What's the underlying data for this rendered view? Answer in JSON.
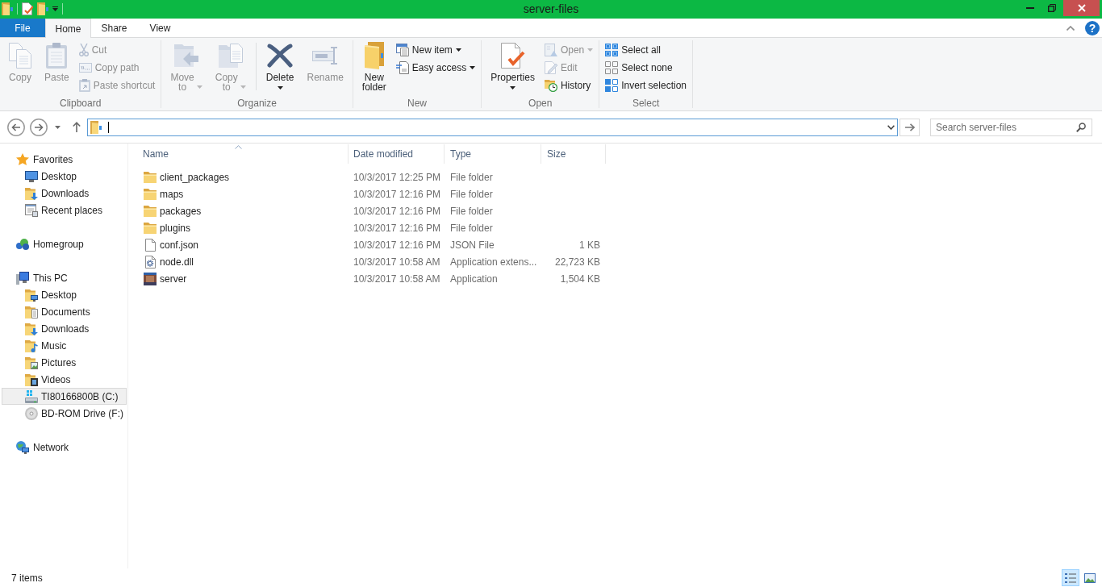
{
  "window": {
    "title": "server-files"
  },
  "ribbon": {
    "tabs": [
      {
        "label": "File",
        "kind": "menu",
        "selected": false
      },
      {
        "label": "Home",
        "kind": "tab",
        "selected": true
      },
      {
        "label": "Share",
        "kind": "tab",
        "selected": false
      },
      {
        "label": "View",
        "kind": "tab",
        "selected": false
      }
    ],
    "help_button": {
      "label": "?"
    },
    "groups": [
      {
        "label": "Clipboard",
        "commands": [
          {
            "label": "Copy",
            "kind": "large",
            "dropdown": false,
            "disabled": true
          },
          {
            "label": "Paste",
            "kind": "large",
            "dropdown": false,
            "disabled": true
          },
          {
            "label": "Cut",
            "kind": "small",
            "dropdown": false,
            "disabled": true
          },
          {
            "label": "Copy path",
            "kind": "small",
            "dropdown": false,
            "disabled": true
          },
          {
            "label": "Paste shortcut",
            "kind": "small",
            "dropdown": false,
            "disabled": true
          }
        ]
      },
      {
        "label": "Organize",
        "commands": [
          {
            "label": "Move to",
            "kind": "large",
            "dropdown": true,
            "disabled": true
          },
          {
            "label": "Copy to",
            "kind": "large",
            "dropdown": true,
            "disabled": true
          },
          {
            "label": "Delete",
            "kind": "split",
            "dropdown": true,
            "disabled": false,
            "divider_before": true
          },
          {
            "label": "Rename",
            "kind": "large",
            "dropdown": false,
            "disabled": true
          }
        ]
      },
      {
        "label": "New",
        "commands": [
          {
            "label": "New folder",
            "kind": "large",
            "dropdown": false,
            "disabled": false
          },
          {
            "label": "New item",
            "kind": "small",
            "dropdown": true,
            "disabled": false
          },
          {
            "label": "Easy access",
            "kind": "small",
            "dropdown": true,
            "disabled": false
          }
        ]
      },
      {
        "label": "Open",
        "commands": [
          {
            "label": "Properties",
            "kind": "split",
            "dropdown": true,
            "disabled": false
          },
          {
            "label": "Open",
            "kind": "small",
            "dropdown": true,
            "disabled": true
          },
          {
            "label": "Edit",
            "kind": "small",
            "dropdown": false,
            "disabled": true
          },
          {
            "label": "History",
            "kind": "small",
            "dropdown": false,
            "disabled": false
          }
        ]
      },
      {
        "label": "Select",
        "commands": [
          {
            "label": "Select all",
            "kind": "small",
            "dropdown": false,
            "disabled": false
          },
          {
            "label": "Select none",
            "kind": "small",
            "dropdown": false,
            "disabled": false
          },
          {
            "label": "Invert selection",
            "kind": "small",
            "dropdown": false,
            "disabled": false
          }
        ]
      }
    ]
  },
  "search": {
    "placeholder": "Search server-files"
  },
  "nav": {
    "sections": [
      {
        "label": "Favorites",
        "selected": false,
        "children": [
          {
            "label": "Desktop",
            "selected": false
          },
          {
            "label": "Downloads",
            "selected": false
          },
          {
            "label": "Recent places",
            "selected": false
          }
        ]
      },
      {
        "label": "Homegroup",
        "selected": false
      },
      {
        "label": "This PC",
        "selected": false,
        "children": [
          {
            "label": "Desktop",
            "selected": false
          },
          {
            "label": "Documents",
            "selected": false
          },
          {
            "label": "Downloads",
            "selected": false
          },
          {
            "label": "Music",
            "selected": false
          },
          {
            "label": "Pictures",
            "selected": false
          },
          {
            "label": "Videos",
            "selected": false
          },
          {
            "label": "TI80166800B (C:)",
            "selected": true
          },
          {
            "label": "BD-ROM Drive (F:)",
            "selected": false
          }
        ]
      },
      {
        "label": "Network",
        "selected": false
      }
    ]
  },
  "file_list": {
    "columns": [
      {
        "label": "Name",
        "sorted": true
      },
      {
        "label": "Date modified",
        "sorted": false
      },
      {
        "label": "Type",
        "sorted": false
      },
      {
        "label": "Size",
        "sorted": false
      }
    ],
    "rows": [
      {
        "kind": "folder",
        "name": "client_packages",
        "date_modified": "10/3/2017 12:25 PM",
        "type": "File folder"
      },
      {
        "kind": "folder",
        "name": "maps",
        "date_modified": "10/3/2017 12:16 PM",
        "type": "File folder"
      },
      {
        "kind": "folder",
        "name": "packages",
        "date_modified": "10/3/2017 12:16 PM",
        "type": "File folder"
      },
      {
        "kind": "folder",
        "name": "plugins",
        "date_modified": "10/3/2017 12:16 PM",
        "type": "File folder"
      },
      {
        "kind": "file",
        "name": "conf.json",
        "date_modified": "10/3/2017 12:16 PM",
        "type": "JSON File",
        "size": "1 KB"
      },
      {
        "kind": "library",
        "name": "node.dll",
        "date_modified": "10/3/2017 10:58 AM",
        "type": "Application extens...",
        "size": "22,723 KB"
      },
      {
        "kind": "application",
        "name": "server",
        "date_modified": "10/3/2017 10:58 AM",
        "type": "Application",
        "size": "1,504 KB"
      }
    ]
  },
  "status_bar": {
    "text": "7 items",
    "views": [
      {
        "selected": true
      },
      {
        "selected": false
      }
    ]
  }
}
